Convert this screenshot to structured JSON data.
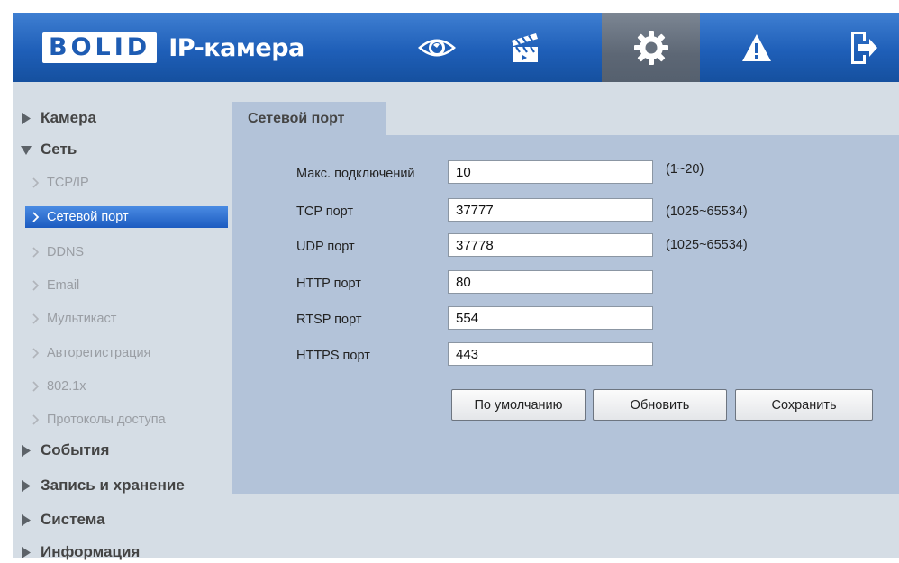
{
  "header": {
    "logo_text": "BOLID",
    "title": "IP-камера",
    "nav_icons": [
      "eye-icon",
      "clapperboard-icon",
      "gear-icon",
      "warning-icon",
      "logout-icon"
    ],
    "active_nav": "gear-icon",
    "accent": "#1f5fb8"
  },
  "sidebar": {
    "sections": [
      {
        "label": "Камера",
        "expanded": false
      },
      {
        "label": "Сеть",
        "expanded": true
      },
      {
        "label": "События",
        "expanded": false
      },
      {
        "label": "Запись и хранение",
        "expanded": false
      },
      {
        "label": "Система",
        "expanded": false
      },
      {
        "label": "Информация",
        "expanded": false
      }
    ],
    "network_items": [
      "TCP/IP",
      "Сетевой порт",
      "DDNS",
      "Email",
      "Мультикаст",
      "Авторегистрация",
      "802.1x",
      "Протоколы доступа"
    ],
    "selected_item": "Сетевой порт"
  },
  "content": {
    "tab": "Сетевой порт",
    "fields": [
      {
        "label": "Макс. подключений",
        "value": "10",
        "range": "(1~20)"
      },
      {
        "label": "TCP порт",
        "value": "37777",
        "range": "(1025~65534)"
      },
      {
        "label": "UDP порт",
        "value": "37778",
        "range": "(1025~65534)"
      },
      {
        "label": "HTTP порт",
        "value": "80"
      },
      {
        "label": "RTSP порт",
        "value": "554"
      },
      {
        "label": "HTTPS порт",
        "value": "443"
      }
    ],
    "buttons": {
      "default": "По умолчанию",
      "refresh": "Обновить",
      "save": "Сохранить"
    }
  }
}
